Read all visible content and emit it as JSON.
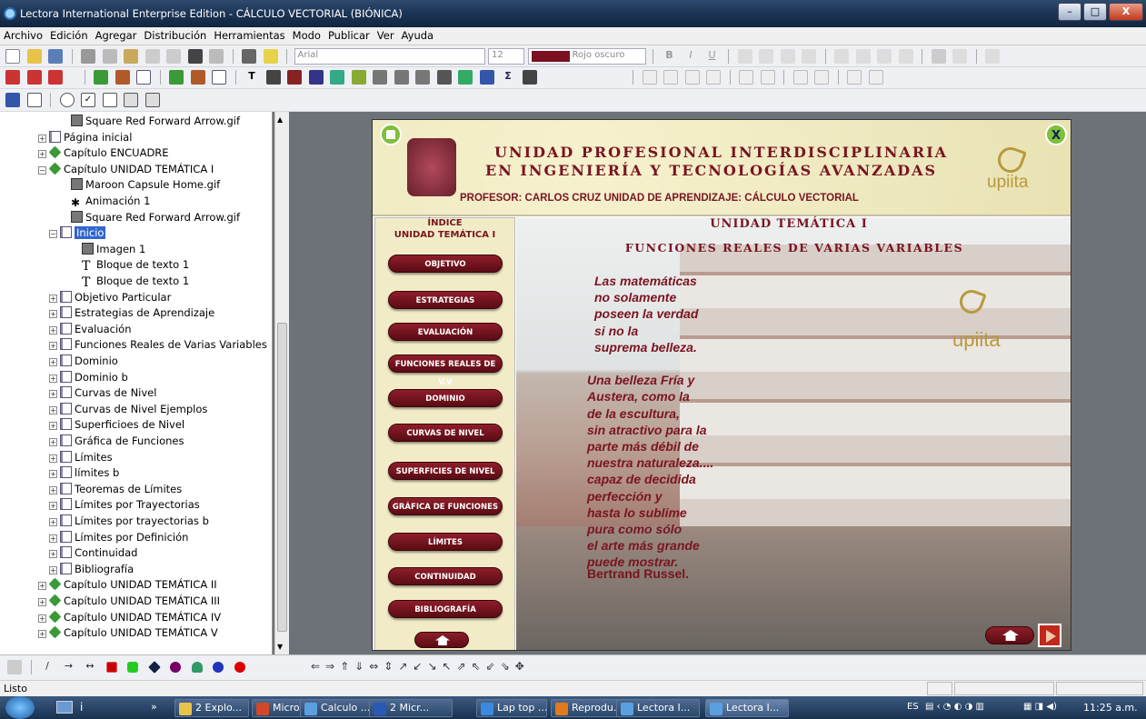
{
  "window": {
    "title": "Lectora International Enterprise Edition - CÁLCULO  VECTORIAL (BIÓNICA)",
    "min": "–",
    "max": "□",
    "close": "X"
  },
  "menubar": [
    "Archivo",
    "Edición",
    "Agregar",
    "Distribución",
    "Herramientas",
    "Modo",
    "Publicar",
    "Ver",
    "Ayuda"
  ],
  "format_toolbar": {
    "font": "Arial",
    "size": "12",
    "color_name": "Rojo oscuro",
    "color_hex": "#7a1020"
  },
  "tree": [
    {
      "label": "Square Red  Forward Arrow.gif",
      "icon": "image-icon",
      "indent": 5,
      "exp": ""
    },
    {
      "label": "Página inicial",
      "icon": "page-icon",
      "indent": 3,
      "exp": "+"
    },
    {
      "label": "Capítulo ENCUADRE",
      "icon": "chapter-icon",
      "indent": 3,
      "exp": "+"
    },
    {
      "label": "Capítulo UNIDAD TEMÁTICA I",
      "icon": "chapter-icon",
      "indent": 3,
      "exp": "-"
    },
    {
      "label": "Maroon Capsule Home.gif",
      "icon": "image-icon",
      "indent": 5,
      "exp": ""
    },
    {
      "label": "Animación 1",
      "icon": "animation-icon",
      "indent": 5,
      "exp": ""
    },
    {
      "label": "Square Red  Forward Arrow.gif",
      "icon": "image-icon",
      "indent": 5,
      "exp": ""
    },
    {
      "label": "Inicio",
      "icon": "page-icon",
      "indent": 4,
      "exp": "-",
      "selected": true
    },
    {
      "label": "Imagen 1",
      "icon": "camera-icon",
      "indent": 6,
      "exp": ""
    },
    {
      "label": "Bloque de texto 1",
      "icon": "text-icon",
      "indent": 6,
      "exp": ""
    },
    {
      "label": "Bloque de texto 1",
      "icon": "text-icon",
      "indent": 6,
      "exp": ""
    },
    {
      "label": "Objetivo Particular",
      "icon": "page-icon",
      "indent": 4,
      "exp": "+"
    },
    {
      "label": "Estrategias de Aprendizaje",
      "icon": "page-icon",
      "indent": 4,
      "exp": "+"
    },
    {
      "label": "Evaluación",
      "icon": "page-icon",
      "indent": 4,
      "exp": "+"
    },
    {
      "label": "Funciones Reales de Varias Variables",
      "icon": "page-icon",
      "indent": 4,
      "exp": "+"
    },
    {
      "label": "Dominio",
      "icon": "page-icon",
      "indent": 4,
      "exp": "+"
    },
    {
      "label": "Dominio b",
      "icon": "page-icon",
      "indent": 4,
      "exp": "+"
    },
    {
      "label": "Curvas de Nivel",
      "icon": "page-icon",
      "indent": 4,
      "exp": "+"
    },
    {
      "label": "Curvas de Nivel Ejemplos",
      "icon": "page-icon",
      "indent": 4,
      "exp": "+"
    },
    {
      "label": "Superficioes de Nivel",
      "icon": "page-icon",
      "indent": 4,
      "exp": "+"
    },
    {
      "label": "Gráfica de Funciones",
      "icon": "page-icon",
      "indent": 4,
      "exp": "+"
    },
    {
      "label": "Límites",
      "icon": "page-icon",
      "indent": 4,
      "exp": "+"
    },
    {
      "label": "límites b",
      "icon": "page-icon",
      "indent": 4,
      "exp": "+"
    },
    {
      "label": "Teoremas  de Límites",
      "icon": "page-icon",
      "indent": 4,
      "exp": "+"
    },
    {
      "label": "Límites por Trayectorias",
      "icon": "page-icon",
      "indent": 4,
      "exp": "+"
    },
    {
      "label": "Límites por trayectorias b",
      "icon": "page-icon",
      "indent": 4,
      "exp": "+"
    },
    {
      "label": "Límites por Definición",
      "icon": "page-icon",
      "indent": 4,
      "exp": "+"
    },
    {
      "label": "Continuidad",
      "icon": "page-icon",
      "indent": 4,
      "exp": "+"
    },
    {
      "label": "Bibliografía",
      "icon": "page-icon",
      "indent": 4,
      "exp": "+"
    },
    {
      "label": "Capítulo UNIDAD TEMÁTICA II",
      "icon": "chapter-icon",
      "indent": 3,
      "exp": "+"
    },
    {
      "label": "Capítulo UNIDAD TEMÁTICA III",
      "icon": "chapter-icon",
      "indent": 3,
      "exp": "+"
    },
    {
      "label": "Capítulo UNIDAD TEMÁTICA IV",
      "icon": "chapter-icon",
      "indent": 3,
      "exp": "+"
    },
    {
      "label": "Capítulo UNIDAD TEMÁTICA V",
      "icon": "chapter-icon",
      "indent": 3,
      "exp": "+"
    }
  ],
  "page": {
    "banner_line1": "UNIDAD PROFESIONAL INTERDISCIPLINARIA",
    "banner_line2": "EN INGENIERÍA Y TECNOLOGÍAS AVANZADAS",
    "banner_line3": "PROFESOR:  CARLOS CRUZ    UNIDAD  DE  APRENDIZAJE:   CÁLCULO VECTORIAL",
    "logo_text": "upiita",
    "close_glyph": "X",
    "index_title_1": "ÍNDICE",
    "index_title_2": "UNIDAD TEMÁTICA I",
    "heading_1": "UNIDAD TEMÁTICA I",
    "heading_2": "FUNCIONES REALES DE VARIAS VARIABLES",
    "menu": [
      "OBJETIVO",
      "ESTRATEGIAS",
      "EVALUACIÓN",
      "FUNCIONES REALES DE V.V",
      "DOMINIO",
      "CURVAS DE NIVEL",
      "SUPERFICIES DE NIVEL",
      "GRÁFICA DE FUNCIONES",
      "LÍMITES",
      "CONTINUIDAD",
      "BIBLIOGRAFÍA"
    ],
    "quote": [
      "Las matemáticas",
      "no solamente",
      "poseen la verdad",
      "si no la",
      "suprema belleza.",
      "",
      "Una belleza Fría y",
      "Austera, como la",
      "de la escultura,",
      "sin atractivo para la",
      "parte más débil de",
      "nuestra naturaleza....",
      "capaz de decidida",
      "perfección  y",
      "hasta lo sublime",
      "pura como sólo",
      "el arte más grande",
      "puede mostrar."
    ],
    "author": "Bertrand Russel."
  },
  "status": "Listo",
  "taskbar": {
    "items": [
      "2 Explo...",
      "Microsof...",
      "Calculo ...",
      "2 Micr...",
      "Lap top ...",
      "Reprodu...",
      "Lectora I...",
      "Lectora I..."
    ],
    "lang": "ES",
    "clock": "11:25 a.m."
  }
}
